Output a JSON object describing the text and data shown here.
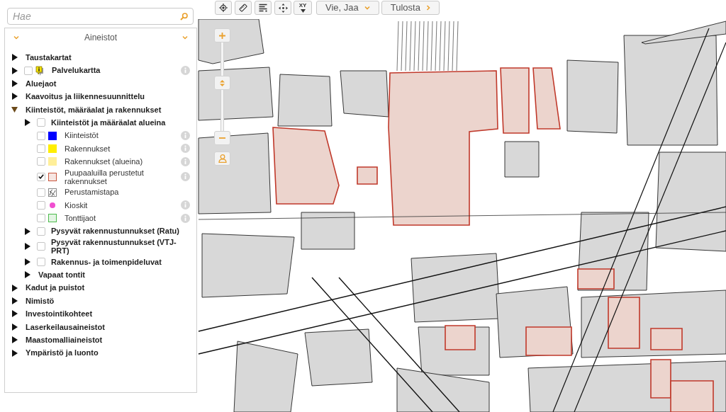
{
  "toolbar": {
    "tools": [
      {
        "kind": "locate"
      },
      {
        "kind": "measure"
      },
      {
        "kind": "legend"
      },
      {
        "kind": "pan"
      },
      {
        "kind": "coordinates",
        "label": "XY"
      }
    ],
    "menus": [
      {
        "label": "Vie, Jaa",
        "kind": "dropdown"
      },
      {
        "label": "Tulosta",
        "kind": "submenu"
      }
    ]
  },
  "search": {
    "placeholder": "Hae"
  },
  "layers_panel": {
    "title": "Aineistot",
    "items": [
      {
        "label": "Taustakartat",
        "kind": "group",
        "expanded": false
      },
      {
        "label": "Palvelukartta",
        "kind": "marker",
        "expanded": false,
        "checked": false,
        "info": true
      },
      {
        "label": "Aluejaot",
        "kind": "group",
        "expanded": false
      },
      {
        "label": "Kaavoitus ja liikennesuunnittelu",
        "kind": "group",
        "expanded": false
      },
      {
        "label": "Kiinteistöt, määräalat ja rakennukset",
        "kind": "group",
        "expanded": true,
        "children": [
          {
            "label": "Kiinteistöt ja määräalat alueina",
            "kind": "group",
            "expanded": false,
            "checked": false,
            "info": false
          },
          {
            "label": "Kiinteistöt",
            "kind": "fill",
            "checked": false,
            "color": "#0000ff",
            "info": true
          },
          {
            "label": "Rakennukset",
            "kind": "fill",
            "checked": false,
            "color": "#ffee00",
            "info": true
          },
          {
            "label": "Rakennukset (alueina)",
            "kind": "fill",
            "checked": false,
            "color": "#ffef99",
            "info": true
          },
          {
            "label": "Puupaaluilla perustetut rakennukset",
            "kind": "outline",
            "checked": true,
            "color": "#c8553d",
            "info": true
          },
          {
            "label": "Perustamistapa",
            "kind": "pattern",
            "checked": false,
            "info": false
          },
          {
            "label": "Kioskit",
            "kind": "dot",
            "checked": false,
            "color": "#f04fd0",
            "info": true
          },
          {
            "label": "Tonttijaot",
            "kind": "outline",
            "checked": false,
            "color": "#4cbb4c",
            "info": true
          },
          {
            "label": "Pysyvät rakennustunnukset (Ratu)",
            "kind": "group",
            "expanded": false,
            "checked": false,
            "info": false
          },
          {
            "label": "Pysyvät rakennustunnukset (VTJ-PRT)",
            "kind": "group",
            "expanded": false,
            "checked": false,
            "info": false
          },
          {
            "label": "Rakennus- ja toimenpideluvat",
            "kind": "group",
            "expanded": false,
            "checked": false,
            "info": false
          },
          {
            "label": "Vapaat tontit",
            "kind": "group",
            "expanded": false
          }
        ]
      },
      {
        "label": "Kadut ja puistot",
        "kind": "group",
        "expanded": false
      },
      {
        "label": "Nimistö",
        "kind": "group",
        "expanded": false
      },
      {
        "label": "Investointikohteet",
        "kind": "group",
        "expanded": false
      },
      {
        "label": "Laserkeilausaineistot",
        "kind": "group",
        "expanded": false
      },
      {
        "label": "Maastomalliaineistot",
        "kind": "group",
        "expanded": false
      },
      {
        "label": "Ympäristö ja luonto",
        "kind": "group",
        "expanded": false
      }
    ]
  },
  "zoom": {
    "level": 0.55
  }
}
